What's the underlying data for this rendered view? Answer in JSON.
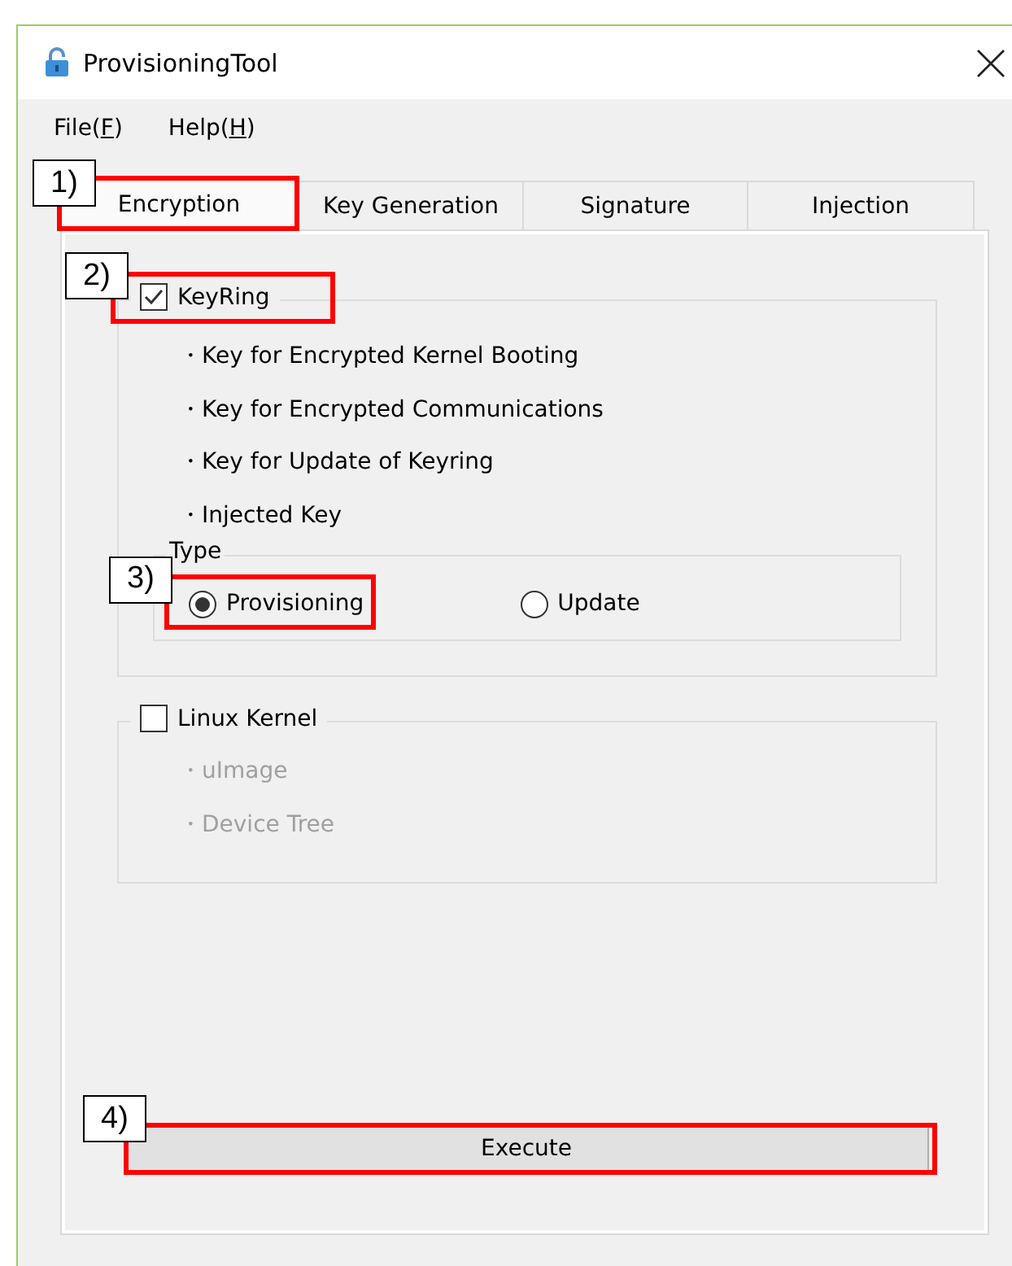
{
  "window": {
    "title": "ProvisioningTool"
  },
  "menu": [
    {
      "label": "File(",
      "key": "F",
      "end": ")"
    },
    {
      "label": "Help(",
      "key": "H",
      "end": ")"
    }
  ],
  "tabs": [
    {
      "label": "Encryption",
      "selected": true,
      "callout": "1)"
    },
    {
      "label": "Key Generation",
      "selected": false
    },
    {
      "label": "Signature",
      "selected": false
    },
    {
      "label": "Injection",
      "selected": false
    }
  ],
  "groups": [
    {
      "label": "KeyRing",
      "checked": true,
      "callout": "2)",
      "items": [
        {
          "text": "・Key for Encrypted Kernel Booting",
          "disabled": false
        },
        {
          "text": "・Key for Encrypted Communications",
          "disabled": false
        },
        {
          "text": "・Key for Update of Keyring",
          "disabled": false
        },
        {
          "text": "・Injected Key",
          "disabled": false
        }
      ],
      "type": {
        "label": "Type",
        "options": [
          {
            "label": "Provisioning",
            "selected": true,
            "callout": "3)"
          },
          {
            "label": "Update",
            "selected": false
          }
        ]
      }
    },
    {
      "label": "Linux Kernel",
      "checked": false,
      "items": [
        {
          "text": "・uImage",
          "disabled": true
        },
        {
          "text": "・Device Tree",
          "disabled": true
        }
      ]
    }
  ],
  "execute": {
    "label": "Execute",
    "callout": "4)"
  }
}
